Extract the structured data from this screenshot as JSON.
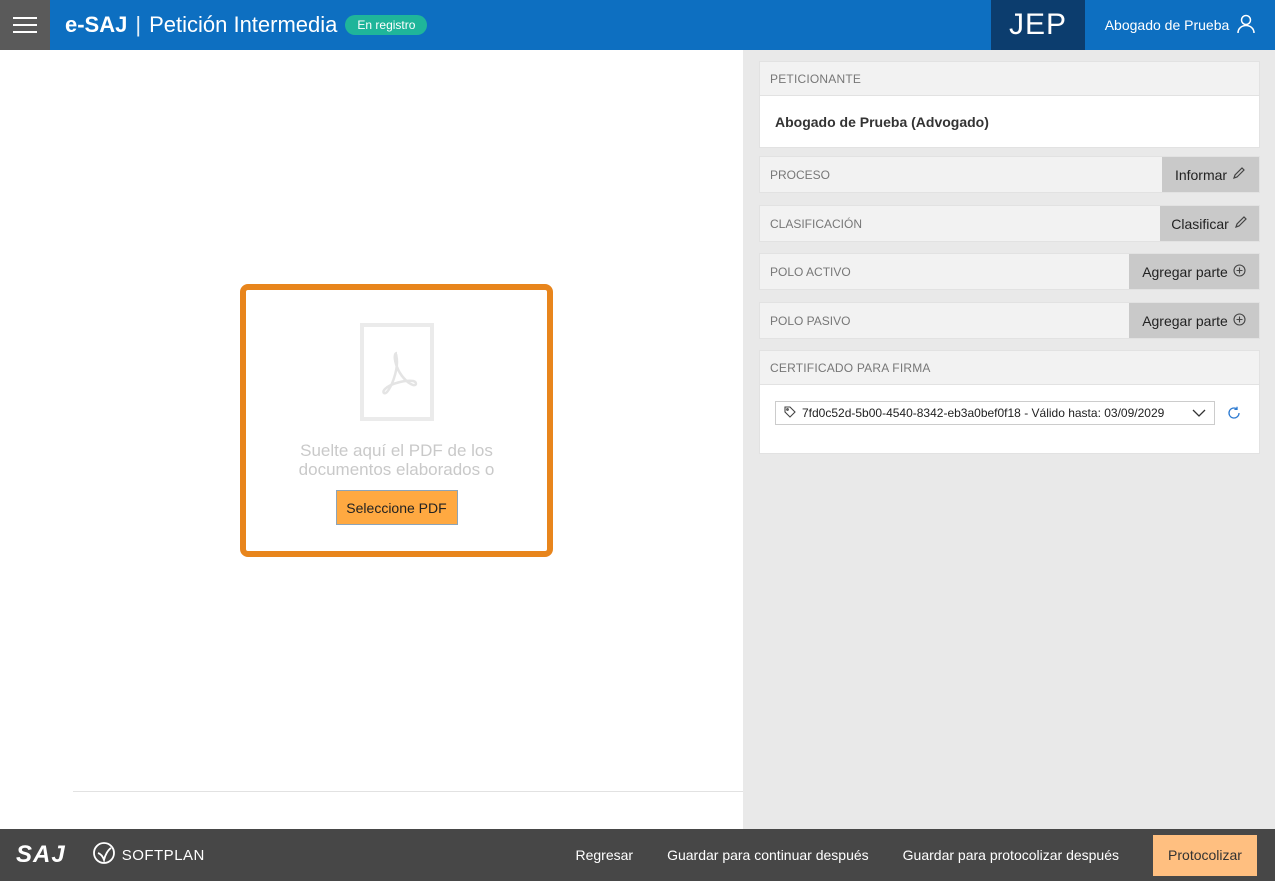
{
  "header": {
    "menu_icon": "hamburger-menu-icon",
    "app_name": "e-SAJ",
    "separator": "|",
    "page_title": "Petición Intermedia",
    "status_badge": "En registro",
    "tenant": "JEP",
    "user_name": "Abogado de Prueba",
    "user_icon": "user-icon",
    "accent_color": "#0d6fc1",
    "badge_color": "#1fb59a"
  },
  "dropzone": {
    "icon": "pdf-document-icon",
    "text": "Suelte aquí el PDF de los documentos elaborados o",
    "button_label": "Seleccione PDF",
    "border_color": "#e8851c"
  },
  "panel": {
    "peticionante": {
      "title": "PETICIONANTE",
      "value": "Abogado de Prueba (Advogado)"
    },
    "proceso": {
      "title": "PROCESO",
      "action": "Informar",
      "action_icon": "pencil-icon"
    },
    "clasificacion": {
      "title": "CLASIFICACIÓN",
      "action": "Clasificar",
      "action_icon": "pencil-icon"
    },
    "polo_activo": {
      "title": "POLO ACTIVO",
      "action": "Agregar parte",
      "action_icon": "plus-circle-icon"
    },
    "polo_pasivo": {
      "title": "POLO PASIVO",
      "action": "Agregar parte",
      "action_icon": "plus-circle-icon"
    },
    "certificado": {
      "title": "CERTIFICADO PARA FIRMA",
      "selected": "7fd0c52d-5b00-4540-8342-eb3a0bef0f18 - Válido hasta: 03/09/2029",
      "tag_icon": "tag-icon",
      "dropdown_icon": "chevron-down-icon",
      "refresh_icon": "refresh-icon"
    }
  },
  "footer": {
    "logo_saj": "SAJ",
    "logo_softplan": "SOFTPLAN",
    "regresar": "Regresar",
    "guardar_continuar": "Guardar para continuar después",
    "guardar_protocolizar": "Guardar para protocolizar después",
    "protocolizar": "Protocolizar",
    "protocolizar_color": "#ffbf80"
  }
}
